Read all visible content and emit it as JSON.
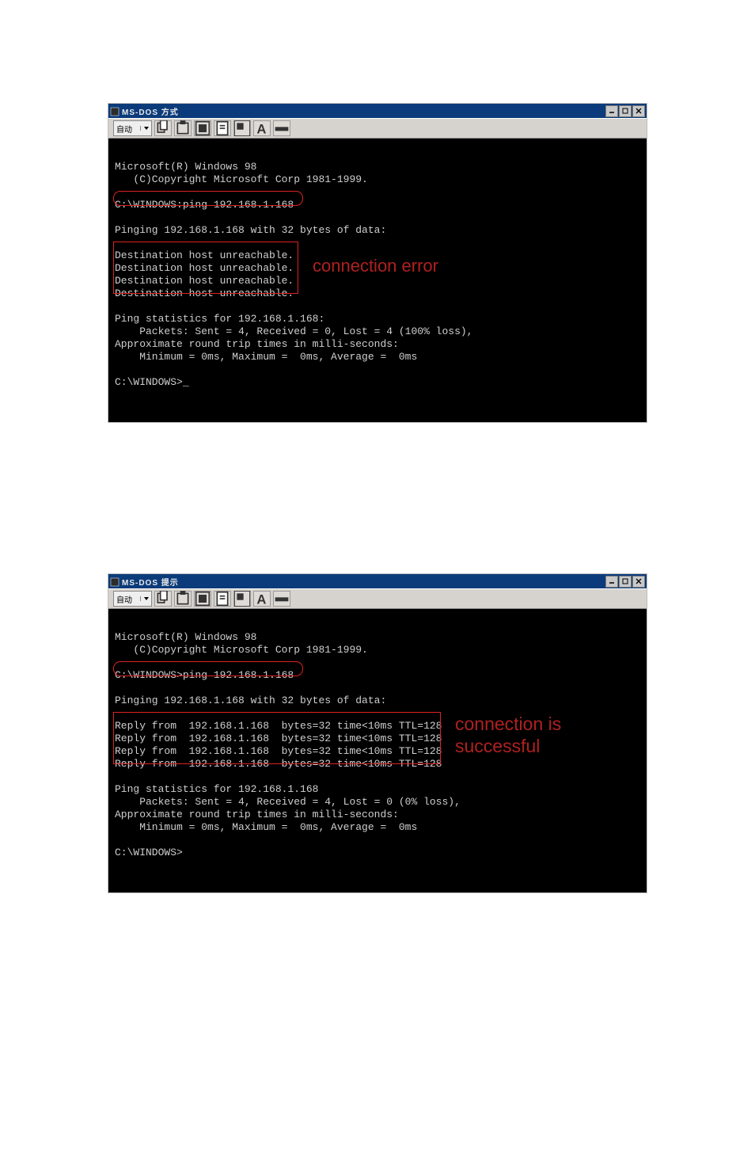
{
  "win1": {
    "title": "MS-DOS 方式",
    "toolbar_dropdown": "自动",
    "cmd_highlight_text": "C:\\WINDOWS:ping 192.168.1.168",
    "annotation": "connection error",
    "console_lines": [
      "",
      "Microsoft(R) Windows 98",
      "   (C)Copyright Microsoft Corp 1981-1999.",
      "",
      "C:\\WINDOWS:ping 192.168.1.168",
      "",
      "Pinging 192.168.1.168 with 32 bytes of data:",
      "",
      "Destination host unreachable.",
      "Destination host unreachable.",
      "Destination host unreachable.",
      "Destination host unreachable.",
      "",
      "Ping statistics for 192.168.1.168:",
      "    Packets: Sent = 4, Received = 0, Lost = 4 (100% loss),",
      "Approximate round trip times in milli-seconds:",
      "    Minimum = 0ms, Maximum =  0ms, Average =  0ms",
      "",
      "C:\\WINDOWS>_",
      "",
      "",
      ""
    ]
  },
  "win2": {
    "title": "MS-DOS 提示",
    "toolbar_dropdown": "自动",
    "cmd_highlight_text": "C:\\WINDOWS>ping 192.168.1.168",
    "annotation_line1": "connection is",
    "annotation_line2": "successful",
    "console_lines": [
      "",
      "Microsoft(R) Windows 98",
      "   (C)Copyright Microsoft Corp 1981-1999.",
      "",
      "C:\\WINDOWS>ping 192.168.1.168",
      "",
      "Pinging 192.168.1.168 with 32 bytes of data:",
      "",
      "Reply from  192.168.1.168  bytes=32 time<10ms TTL=128",
      "Reply from  192.168.1.168  bytes=32 time<10ms TTL=128",
      "Reply from  192.168.1.168  bytes=32 time<10ms TTL=128",
      "Reply from  192.168.1.168  bytes=32 time<10ms TTL=128",
      "",
      "Ping statistics for 192.168.1.168",
      "    Packets: Sent = 4, Received = 4, Lost = 0 (0% loss),",
      "Approximate round trip times in milli-seconds:",
      "    Minimum = 0ms, Maximum =  0ms, Average =  0ms",
      "",
      "C:\\WINDOWS>",
      "",
      "",
      ""
    ]
  }
}
